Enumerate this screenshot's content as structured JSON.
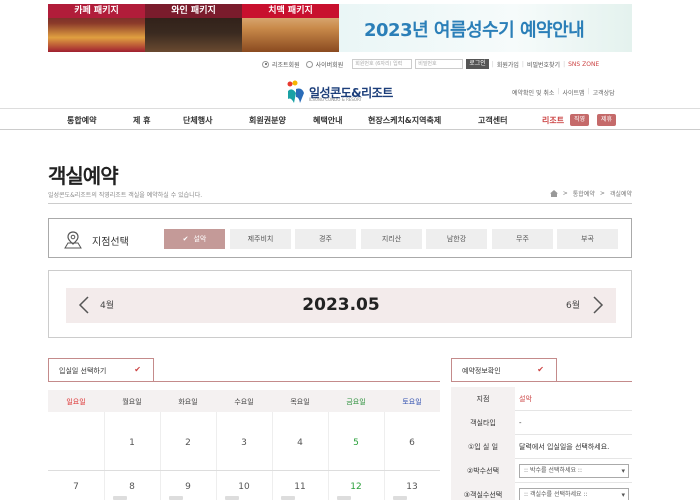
{
  "banners": {
    "pkg1": "카페 패키지",
    "pkg2": "와인 패키지",
    "pkg3": "치맥 패키지",
    "summer": "2023년 여름성수기 예약안내"
  },
  "util": {
    "member_resort": "리조트회원",
    "member_cyber": "사이버회원",
    "id_placeholder": "회원번호 (6자리) 입력",
    "pw_placeholder": "비밀번호",
    "login": "로그인",
    "join": "회원가입",
    "find_pw": "비밀번호찾기",
    "sns": "SNS ZONE"
  },
  "logo": {
    "title": "일성콘도&리조트",
    "subtitle": "ILSUNG CONDO & RESORT"
  },
  "top_links": [
    "예약확인 및 취소",
    "사이트맵",
    "고객상담"
  ],
  "nav": {
    "items": [
      "통합예약",
      "제 휴",
      "단체행사",
      "회원권분양",
      "혜택안내",
      "현장스케치&지역축제",
      "고객센터"
    ],
    "resort": "리조트",
    "tags": [
      "직영",
      "제휴"
    ]
  },
  "page": {
    "title": "객실예약",
    "desc": "일성콘도&리조트의 직영리조트 객실을 예약하실 수 있습니다.",
    "breadcrumb": [
      "통합예약",
      "객실예약"
    ]
  },
  "branch": {
    "label": "지점선택",
    "items": [
      "설악",
      "제주비치",
      "경주",
      "지리산",
      "남한강",
      "무주",
      "부곡"
    ],
    "selected": "설악"
  },
  "month": {
    "prev": "4월",
    "current": "2023.05",
    "next": "6월"
  },
  "calendar": {
    "tab": "입실일 선택하기",
    "days": [
      "일요일",
      "월요일",
      "화요일",
      "수요일",
      "목요일",
      "금요일",
      "토요일"
    ],
    "row1": [
      "",
      "1",
      "2",
      "3",
      "4",
      "5",
      "6"
    ],
    "row2": [
      "7",
      "8",
      "9",
      "10",
      "11",
      "12",
      "13"
    ]
  },
  "info": {
    "tab": "예약정보확인",
    "rows": [
      {
        "label": "지점",
        "value": "설악"
      },
      {
        "label": "객실타입",
        "value": "-"
      },
      {
        "label": "①입 실 일",
        "value": "달력에서 입실일을 선택하세요."
      },
      {
        "label": "②박수선택",
        "value": ":: 박수를 선택하세요 ::"
      },
      {
        "label": "③객실수선택",
        "value": ":: 객실수를 선택하세요 ::"
      }
    ]
  },
  "colors": {
    "accent": "#c49a98",
    "brand_red": "#c44444",
    "logo_blue": "#1c3e7a"
  }
}
